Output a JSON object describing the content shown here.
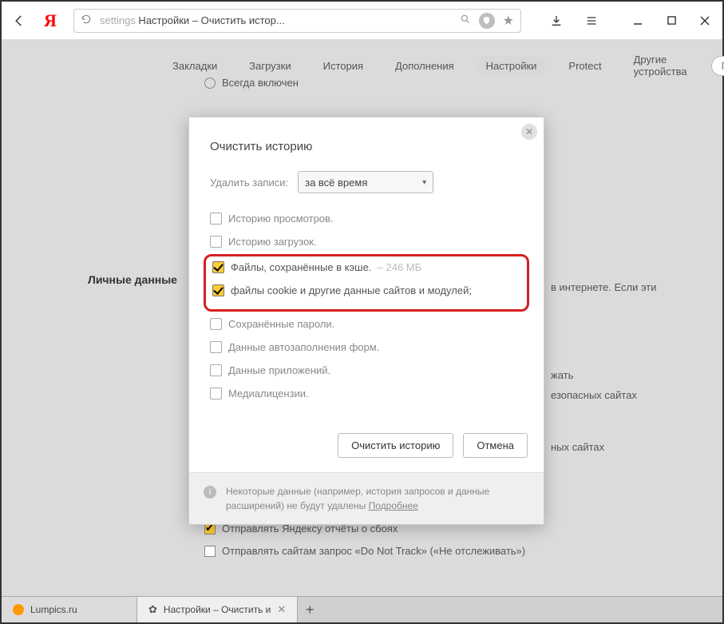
{
  "toolbar": {
    "url_seg1": "settings",
    "url_seg2": " Настройки – Очистить истор..."
  },
  "nav": {
    "tabs": [
      "Закладки",
      "Загрузки",
      "История",
      "Дополнения",
      "Настройки",
      "Protect",
      "Другие устройства"
    ],
    "active_index": 4,
    "search_placeholder": "Пои"
  },
  "sidebar": {
    "section_label": "Личные данные"
  },
  "bg": {
    "radio_label": "Всегда включен",
    "text_right_1": "в интернете. Если эти",
    "text_right_2": "жать",
    "text_right_3": "езопасных сайтах",
    "text_right_4": "ных сайтах",
    "check1": "Отправлять Яндексу отчёты о сбоях",
    "check2": "Отправлять сайтам запрос «Do Not Track» («Не отслеживать»)"
  },
  "modal": {
    "title": "Очистить историю",
    "select_label": "Удалить записи:",
    "select_value": "за всё время",
    "items": [
      {
        "label": "Историю просмотров.",
        "checked": false
      },
      {
        "label": "Историю загрузок.",
        "checked": false
      },
      {
        "label": "Файлы, сохранённые в кэше.",
        "checked": true,
        "size": "246 МБ"
      },
      {
        "label": "файлы cookie и другие данные сайтов и модулей;",
        "checked": true
      },
      {
        "label": "Сохранённые пароли.",
        "checked": false
      },
      {
        "label": "Данные автозаполнения форм.",
        "checked": false
      },
      {
        "label": "Данные приложений.",
        "checked": false
      },
      {
        "label": "Медиалицензии.",
        "checked": false
      }
    ],
    "btn_clear": "Очистить историю",
    "btn_cancel": "Отмена",
    "footer_text": "Некоторые данные (например, история запросов и данные расширений) не будут удалены ",
    "footer_link": "Подробнее"
  },
  "tabs_bottom": {
    "items": [
      {
        "title": "Lumpics.ru",
        "icon": "orange"
      },
      {
        "title": "Настройки – Очистить и",
        "icon": "gear",
        "active": true
      }
    ]
  }
}
